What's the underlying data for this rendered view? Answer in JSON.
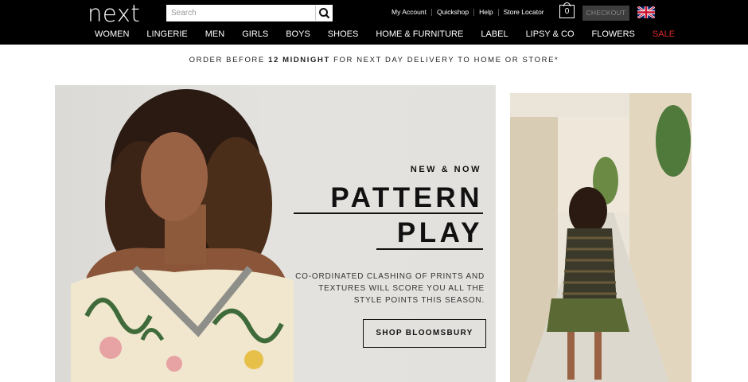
{
  "header": {
    "logo": "next",
    "search_placeholder": "Search",
    "utility_links": [
      "My Account",
      "Quickshop",
      "Help",
      "Store Locator"
    ],
    "bag_count": "0",
    "checkout_label": "CHECKOUT"
  },
  "nav": {
    "items": [
      "WOMEN",
      "LINGERIE",
      "MEN",
      "GIRLS",
      "BOYS",
      "SHOES",
      "HOME & FURNITURE",
      "LABEL",
      "LIPSY & CO",
      "FLOWERS",
      "SALE"
    ]
  },
  "promo": {
    "before": "ORDER BEFORE ",
    "highlight": "12 MIDNIGHT",
    "after": " FOR NEXT DAY DELIVERY TO HOME OR STORE*"
  },
  "hero": {
    "tag": "NEW & NOW",
    "title_line1": "PATTERN",
    "title_line2": "PLAY",
    "copy": "CO-ORDINATED CLASHING OF PRINTS AND TEXTURES WILL SCORE YOU ALL THE STYLE POINTS THIS SEASON.",
    "cta": "SHOP BLOOMSBURY"
  },
  "colors": {
    "header_bg": "#000000",
    "sale": "#e12a2a",
    "checkout_bg": "#3d3d3d"
  }
}
